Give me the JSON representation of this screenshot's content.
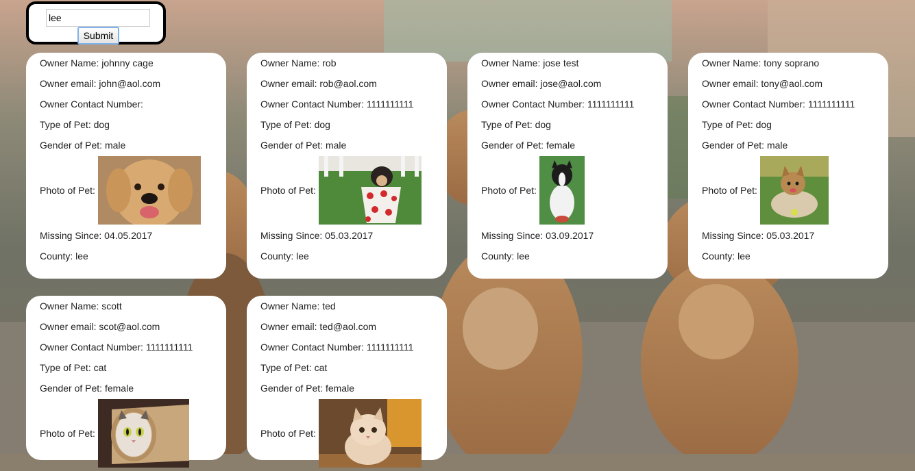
{
  "search": {
    "value": "lee",
    "submit_label": "Submit"
  },
  "labels": {
    "owner_name": "Owner Name:",
    "owner_email": "Owner email:",
    "owner_contact": "Owner Contact Number:",
    "pet_type": "Type of Pet:",
    "pet_gender": "Gender of Pet:",
    "photo": "Photo of Pet:",
    "missing_since": "Missing Since:",
    "county": "County:"
  },
  "cards": [
    {
      "owner_name": "johnny cage",
      "owner_email": "john@aol.com",
      "owner_contact": "",
      "pet_type": "dog",
      "pet_gender": "male",
      "photo_icon": "golden-retriever-photo",
      "missing_since": "04.05.2017",
      "county": "lee"
    },
    {
      "owner_name": "rob",
      "owner_email": "rob@aol.com",
      "owner_contact": "1111111111",
      "pet_type": "dog",
      "pet_gender": "male",
      "photo_icon": "puppy-in-teacup-photo",
      "missing_since": "05.03.2017",
      "county": "lee"
    },
    {
      "owner_name": "jose test",
      "owner_email": "jose@aol.com",
      "owner_contact": "1111111111",
      "pet_type": "dog",
      "pet_gender": "female",
      "photo_icon": "border-collie-photo",
      "missing_since": "03.09.2017",
      "county": "lee"
    },
    {
      "owner_name": "tony soprano",
      "owner_email": "tony@aol.com",
      "owner_contact": "1111111111",
      "pet_type": "dog",
      "pet_gender": "male",
      "photo_icon": "yorkshire-terrier-photo",
      "missing_since": "05.03.2017",
      "county": "lee"
    },
    {
      "owner_name": "scott",
      "owner_email": "scot@aol.com",
      "owner_contact": "1111111111",
      "pet_type": "cat",
      "pet_gender": "female",
      "photo_icon": "cat-in-paper-tube-photo",
      "missing_since": "",
      "county": ""
    },
    {
      "owner_name": "ted",
      "owner_email": "ted@aol.com",
      "owner_contact": "1111111111",
      "pet_type": "cat",
      "pet_gender": "female",
      "photo_icon": "fluffy-kitten-photo",
      "missing_since": "",
      "county": ""
    }
  ]
}
